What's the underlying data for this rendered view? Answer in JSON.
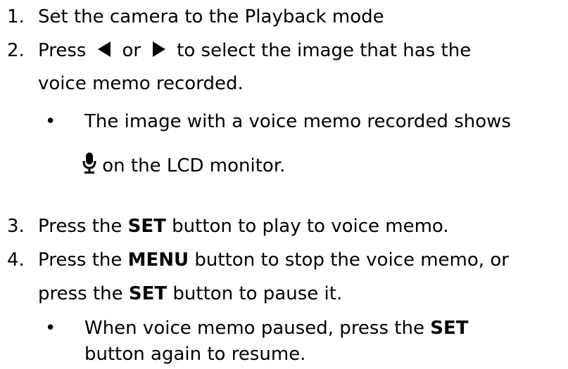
{
  "steps": {
    "s1": "1.",
    "s1_text": "Set the camera to the Playback mode",
    "s2": "2.",
    "s2_a": "Press",
    "s2_or": "or",
    "s2_b": "to select the image that has the",
    "s2_c": "voice memo recorded.",
    "s2_bullet_a": "The image with a voice memo recorded shows",
    "s2_bullet_b": "on the LCD monitor.",
    "s3": "3.",
    "s3_a": "Press the",
    "s3_key": "SET",
    "s3_b": "button to play to voice memo.",
    "s4": "4.",
    "s4_a": "Press the",
    "s4_key1": "MENU",
    "s4_b": "button to stop the voice memo, or",
    "s4_c": "press the",
    "s4_key2": "SET",
    "s4_d": "button to pause it.",
    "s4_bullet_a": "When voice memo paused, press the",
    "s4_key3": "SET",
    "s4_bullet_b": "button again to resume."
  },
  "bullet": "•",
  "icons": {
    "left": "left-arrow-icon",
    "right": "right-arrow-icon",
    "mic": "microphone-icon"
  }
}
